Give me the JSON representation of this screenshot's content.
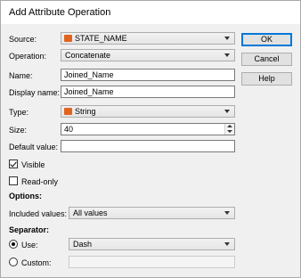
{
  "window": {
    "title": "Add Attribute Operation"
  },
  "fields": {
    "source_label": "Source:",
    "source_value": "STATE_NAME",
    "operation_label": "Operation:",
    "operation_value": "Concatenate",
    "name_label": "Name:",
    "name_value": "Joined_Name",
    "display_name_label": "Display name:",
    "display_name_value": "Joined_Name",
    "type_label": "Type:",
    "type_value": "String",
    "size_label": "Size:",
    "size_value": "40",
    "default_value_label": "Default value:",
    "default_value_value": ""
  },
  "checkboxes": {
    "visible_label": "Visible",
    "visible_checked": true,
    "readonly_label": "Read-only",
    "readonly_checked": false
  },
  "options": {
    "heading": "Options:",
    "included_values_label": "Included values:",
    "included_values_value": "All values"
  },
  "separator": {
    "heading": "Separator:",
    "use_label": "Use:",
    "use_selected": true,
    "use_value": "Dash",
    "custom_label": "Custom:",
    "custom_value": ""
  },
  "buttons": {
    "ok": "OK",
    "cancel": "Cancel",
    "help": "Help"
  },
  "colors": {
    "field_icon": "#e0641e",
    "default_button_border": "#0078d7"
  },
  "icons": {
    "source_icon": "string-field-icon",
    "type_icon": "string-type-icon"
  }
}
